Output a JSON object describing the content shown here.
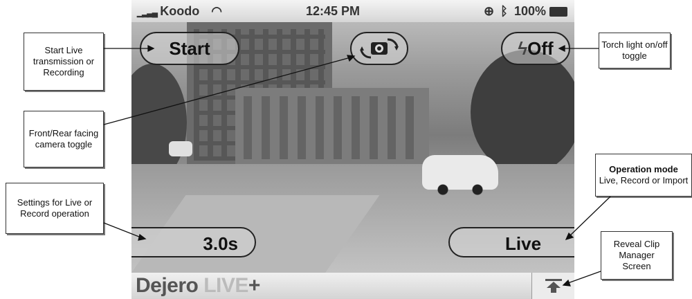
{
  "status_bar": {
    "carrier": "Koodo",
    "time": "12:45 PM",
    "battery": "100%"
  },
  "controls": {
    "start": "Start",
    "camera_toggle_icon": "camera-switch-icon",
    "torch": "Off",
    "torch_icon": "lightning-icon",
    "settings": "3.0s",
    "mode": "Live"
  },
  "bottom_bar": {
    "brand_prefix": "Dejero ",
    "brand_live": "LIVE",
    "brand_plus": "+",
    "reveal_icon": "arrow-up-bar-icon"
  },
  "callouts": {
    "start": "Start Live transmission or Recording",
    "camera": "Front/Rear facing camera toggle",
    "settings": "Settings for Live or Record operation",
    "torch": "Torch light on/off toggle",
    "mode_title": "Operation mode",
    "mode_desc": "Live, Record or Import",
    "reveal": "Reveal Clip Manager Screen"
  }
}
